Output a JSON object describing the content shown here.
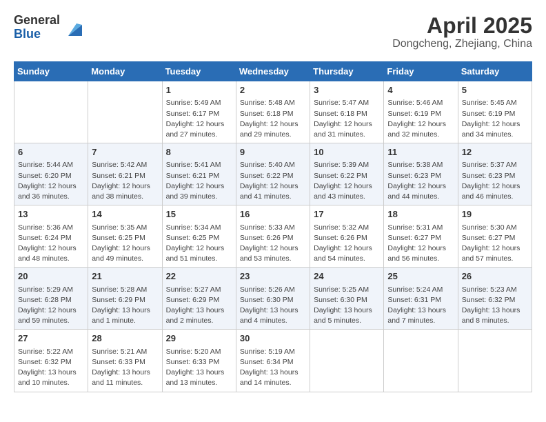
{
  "header": {
    "logo_line1": "General",
    "logo_line2": "Blue",
    "title": "April 2025",
    "subtitle": "Dongcheng, Zhejiang, China"
  },
  "days_of_week": [
    "Sunday",
    "Monday",
    "Tuesday",
    "Wednesday",
    "Thursday",
    "Friday",
    "Saturday"
  ],
  "weeks": [
    [
      {
        "day": "",
        "info": ""
      },
      {
        "day": "",
        "info": ""
      },
      {
        "day": "1",
        "info": "Sunrise: 5:49 AM\nSunset: 6:17 PM\nDaylight: 12 hours and 27 minutes."
      },
      {
        "day": "2",
        "info": "Sunrise: 5:48 AM\nSunset: 6:18 PM\nDaylight: 12 hours and 29 minutes."
      },
      {
        "day": "3",
        "info": "Sunrise: 5:47 AM\nSunset: 6:18 PM\nDaylight: 12 hours and 31 minutes."
      },
      {
        "day": "4",
        "info": "Sunrise: 5:46 AM\nSunset: 6:19 PM\nDaylight: 12 hours and 32 minutes."
      },
      {
        "day": "5",
        "info": "Sunrise: 5:45 AM\nSunset: 6:19 PM\nDaylight: 12 hours and 34 minutes."
      }
    ],
    [
      {
        "day": "6",
        "info": "Sunrise: 5:44 AM\nSunset: 6:20 PM\nDaylight: 12 hours and 36 minutes."
      },
      {
        "day": "7",
        "info": "Sunrise: 5:42 AM\nSunset: 6:21 PM\nDaylight: 12 hours and 38 minutes."
      },
      {
        "day": "8",
        "info": "Sunrise: 5:41 AM\nSunset: 6:21 PM\nDaylight: 12 hours and 39 minutes."
      },
      {
        "day": "9",
        "info": "Sunrise: 5:40 AM\nSunset: 6:22 PM\nDaylight: 12 hours and 41 minutes."
      },
      {
        "day": "10",
        "info": "Sunrise: 5:39 AM\nSunset: 6:22 PM\nDaylight: 12 hours and 43 minutes."
      },
      {
        "day": "11",
        "info": "Sunrise: 5:38 AM\nSunset: 6:23 PM\nDaylight: 12 hours and 44 minutes."
      },
      {
        "day": "12",
        "info": "Sunrise: 5:37 AM\nSunset: 6:23 PM\nDaylight: 12 hours and 46 minutes."
      }
    ],
    [
      {
        "day": "13",
        "info": "Sunrise: 5:36 AM\nSunset: 6:24 PM\nDaylight: 12 hours and 48 minutes."
      },
      {
        "day": "14",
        "info": "Sunrise: 5:35 AM\nSunset: 6:25 PM\nDaylight: 12 hours and 49 minutes."
      },
      {
        "day": "15",
        "info": "Sunrise: 5:34 AM\nSunset: 6:25 PM\nDaylight: 12 hours and 51 minutes."
      },
      {
        "day": "16",
        "info": "Sunrise: 5:33 AM\nSunset: 6:26 PM\nDaylight: 12 hours and 53 minutes."
      },
      {
        "day": "17",
        "info": "Sunrise: 5:32 AM\nSunset: 6:26 PM\nDaylight: 12 hours and 54 minutes."
      },
      {
        "day": "18",
        "info": "Sunrise: 5:31 AM\nSunset: 6:27 PM\nDaylight: 12 hours and 56 minutes."
      },
      {
        "day": "19",
        "info": "Sunrise: 5:30 AM\nSunset: 6:27 PM\nDaylight: 12 hours and 57 minutes."
      }
    ],
    [
      {
        "day": "20",
        "info": "Sunrise: 5:29 AM\nSunset: 6:28 PM\nDaylight: 12 hours and 59 minutes."
      },
      {
        "day": "21",
        "info": "Sunrise: 5:28 AM\nSunset: 6:29 PM\nDaylight: 13 hours and 1 minute."
      },
      {
        "day": "22",
        "info": "Sunrise: 5:27 AM\nSunset: 6:29 PM\nDaylight: 13 hours and 2 minutes."
      },
      {
        "day": "23",
        "info": "Sunrise: 5:26 AM\nSunset: 6:30 PM\nDaylight: 13 hours and 4 minutes."
      },
      {
        "day": "24",
        "info": "Sunrise: 5:25 AM\nSunset: 6:30 PM\nDaylight: 13 hours and 5 minutes."
      },
      {
        "day": "25",
        "info": "Sunrise: 5:24 AM\nSunset: 6:31 PM\nDaylight: 13 hours and 7 minutes."
      },
      {
        "day": "26",
        "info": "Sunrise: 5:23 AM\nSunset: 6:32 PM\nDaylight: 13 hours and 8 minutes."
      }
    ],
    [
      {
        "day": "27",
        "info": "Sunrise: 5:22 AM\nSunset: 6:32 PM\nDaylight: 13 hours and 10 minutes."
      },
      {
        "day": "28",
        "info": "Sunrise: 5:21 AM\nSunset: 6:33 PM\nDaylight: 13 hours and 11 minutes."
      },
      {
        "day": "29",
        "info": "Sunrise: 5:20 AM\nSunset: 6:33 PM\nDaylight: 13 hours and 13 minutes."
      },
      {
        "day": "30",
        "info": "Sunrise: 5:19 AM\nSunset: 6:34 PM\nDaylight: 13 hours and 14 minutes."
      },
      {
        "day": "",
        "info": ""
      },
      {
        "day": "",
        "info": ""
      },
      {
        "day": "",
        "info": ""
      }
    ]
  ]
}
